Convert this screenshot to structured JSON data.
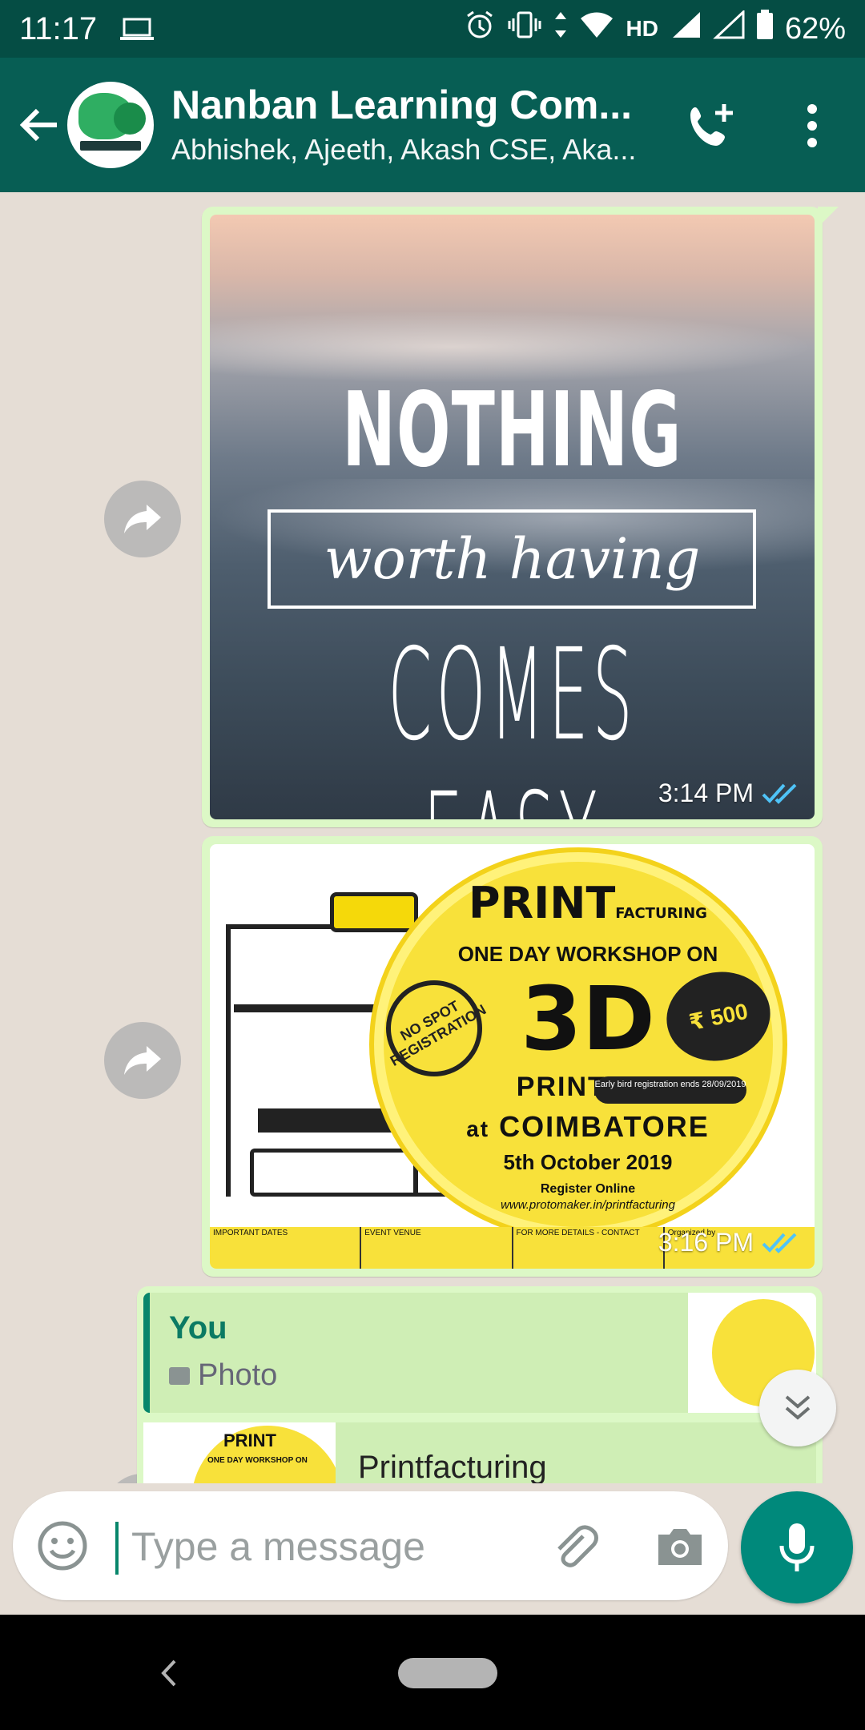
{
  "status_bar": {
    "time": "11:17",
    "network": "HD",
    "battery": "62%"
  },
  "header": {
    "title": "Nanban Learning Com...",
    "members": "Abhishek, Ajeeth, Akash CSE, Aka..."
  },
  "messages": [
    {
      "type": "image",
      "image_text": {
        "line1": "NOTHING",
        "line2": "worth having",
        "line3": "COMES EASY"
      },
      "time": "3:14 PM"
    },
    {
      "type": "image",
      "poster": {
        "brand": "PRINT",
        "brand_sub": "FACTURING",
        "line1": "ONE DAY WORKSHOP ON",
        "big": "3D",
        "line2": "PRINTING",
        "line3": "at",
        "line4": "COIMBATORE",
        "date": "5th October 2019",
        "register": "Register Online",
        "url": "www.protomaker.in/printfacturing",
        "badge_left": "NO SPOT REGISTRATION",
        "badge_right": "₹ 500",
        "early_bird": "Early bird registration ends 28/09/2019",
        "footer": {
          "dates": "IMPORTANT DATES",
          "venue": "EVENT VENUE",
          "contact": "FOR MORE DETAILS - CONTACT",
          "org": "Organized by"
        }
      },
      "time": "3:16 PM"
    },
    {
      "type": "reply",
      "quoted_sender": "You",
      "quoted_type": "Photo",
      "link_title": "Printfacturing"
    }
  ],
  "input": {
    "placeholder": "Type a message"
  },
  "colors": {
    "header": "#075e54",
    "status": "#054d44",
    "bubble": "#dcf8c6",
    "accent": "#00897b"
  }
}
